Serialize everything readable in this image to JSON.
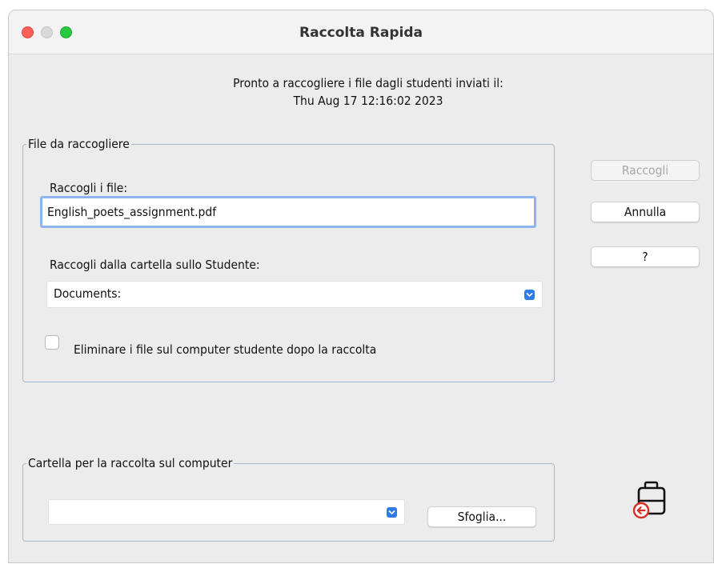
{
  "window": {
    "title": "Raccolta Rapida"
  },
  "status": {
    "line1": "Pronto a raccogliere i file dagli studenti inviati il:",
    "line2": "Thu Aug 17 12:16:02 2023"
  },
  "files_group": {
    "legend": "File da raccogliere",
    "collect_files_label": "Raccogli i file:",
    "collect_files_value": "English_poets_assignment.pdf",
    "folder_label": "Raccogli dalla cartella sullo Studente:",
    "folder_value": "Documents:",
    "delete_label": "Eliminare i file sul computer studente dopo la raccolta",
    "delete_checked": false
  },
  "dest_group": {
    "legend": "Cartella per la raccolta sul computer",
    "folder_value": "",
    "browse_label": "Sfoglia..."
  },
  "buttons": {
    "collect": "Raccogli",
    "cancel": "Annulla",
    "help": "?"
  },
  "icons": {
    "close": "close-traffic-light",
    "minimize": "minimize-traffic-light",
    "maximize": "maximize-traffic-light",
    "collect": "briefcase-collect-icon"
  },
  "colors": {
    "close": "#ff5f57",
    "maximize": "#28c840",
    "focus_ring": "#8fb3f0",
    "select_accent": "#2f7be6",
    "icon_red": "#d93025"
  }
}
